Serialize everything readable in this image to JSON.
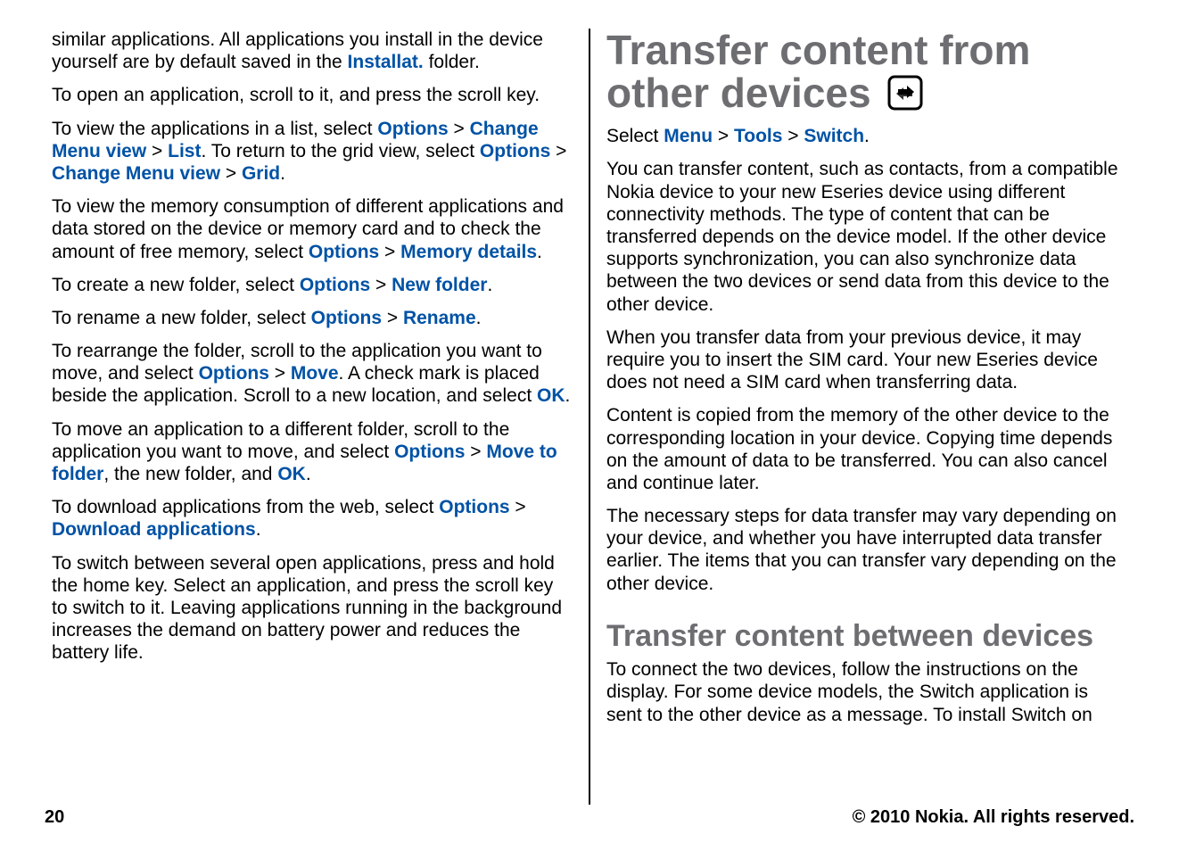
{
  "left": {
    "p1_prefix": "similar applications. All applications you install in the device yourself are by default saved in the ",
    "p1_bold": "Installat.",
    "p1_suffix": " folder.",
    "p2": "To open an application, scroll to it, and press the scroll key.",
    "p3_a": "To view the applications in a list, select ",
    "p3_b": "Options",
    "p3_c": " > ",
    "p3_d": "Change Menu view",
    "p3_e": " > ",
    "p3_f": "List",
    "p3_g": ". To return to the grid view, select ",
    "p3_h": "Options",
    "p3_i": " > ",
    "p3_j": "Change Menu view",
    "p3_k": " > ",
    "p3_l": "Grid",
    "p3_m": ".",
    "p4_a": "To view the memory consumption of different applications and data stored on the device or memory card and to check the amount of free memory, select ",
    "p4_b": "Options",
    "p4_c": " > ",
    "p4_d": "Memory details",
    "p4_e": ".",
    "p5_a": "To create a new folder, select ",
    "p5_b": "Options",
    "p5_c": " > ",
    "p5_d": "New folder",
    "p5_e": ".",
    "p6_a": "To rename a new folder, select ",
    "p6_b": "Options",
    "p6_c": " > ",
    "p6_d": "Rename",
    "p6_e": ".",
    "p7_a": "To rearrange the folder, scroll to the application you want to move, and select ",
    "p7_b": "Options",
    "p7_c": " > ",
    "p7_d": "Move",
    "p7_e": ". A check mark is placed beside the application. Scroll to a new location, and select ",
    "p7_f": "OK",
    "p7_g": ".",
    "p8_a": "To move an application to a different folder, scroll to the application you want to move, and select ",
    "p8_b": "Options",
    "p8_c": " > ",
    "p8_d": "Move to folder",
    "p8_e": ", the new folder, and ",
    "p8_f": "OK",
    "p8_g": ".",
    "p9_a": "To download applications from the web, select ",
    "p9_b": "Options",
    "p9_c": " > ",
    "p9_d": "Download applications",
    "p9_e": ".",
    "p10": "To switch between several open applications, press and hold the home key. Select an application, and press the scroll key to switch to it. Leaving applications running in the background increases the demand on battery power and reduces the battery life."
  },
  "right": {
    "h1": "Transfer content from other devices",
    "nav_a": "Select ",
    "nav_b": "Menu",
    "nav_c": " > ",
    "nav_d": "Tools",
    "nav_e": " > ",
    "nav_f": "Switch",
    "nav_g": ".",
    "r2": "You can transfer content, such as contacts, from a compatible Nokia device to your new Eseries device using different connectivity methods. The type of content that can be transferred depends on the device model. If the other device supports synchronization, you can also synchronize data between the two devices or send data from this device to the other device.",
    "r3": "When you transfer data from your previous device, it may require you to insert the SIM card. Your new Eseries device does not need a SIM card when transferring data.",
    "r4": "Content is copied from the memory of the other device to the corresponding location in your device. Copying time depends on the amount of data to be transferred. You can also cancel and continue later.",
    "r5": "The necessary steps for data transfer may vary depending on your device, and whether you have interrupted data transfer earlier. The items that you can transfer vary depending on the other device.",
    "h2": "Transfer content between devices",
    "r6": "To connect the two devices, follow the instructions on the display. For some device models, the Switch application is sent to the other device as a message. To install Switch on"
  },
  "footer": {
    "page": "20",
    "copyright": "© 2010 Nokia. All rights reserved."
  }
}
